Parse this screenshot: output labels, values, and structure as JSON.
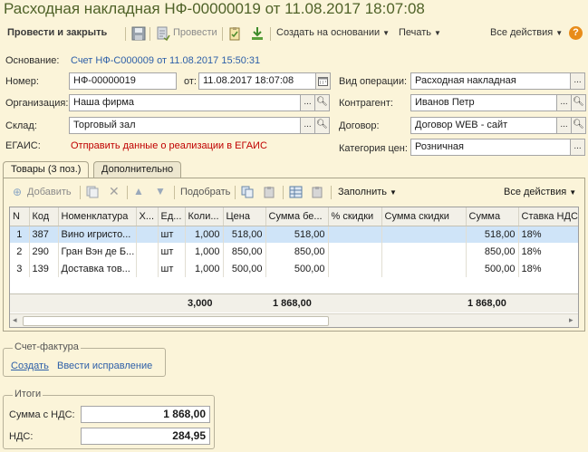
{
  "window": {
    "title": "Расходная накладная НФ-00000019 от 11.08.2017 18:07:08"
  },
  "toolbar": {
    "post_close": "Провести и закрыть",
    "post": "Провести",
    "create_based": "Создать на основании",
    "print": "Печать",
    "all_actions": "Все действия",
    "help": "?"
  },
  "form": {
    "basis_label": "Основание:",
    "basis_link": "Счет НФ-С000009 от 11.08.2017 15:50:31",
    "number_label": "Номер:",
    "number_value": "НФ-00000019",
    "date_label": "от:",
    "date_value": "11.08.2017 18:07:08",
    "operation_label": "Вид операции:",
    "operation_value": "Расходная накладная",
    "org_label": "Организация:",
    "org_value": "Наша фирма",
    "counterparty_label": "Контрагент:",
    "counterparty_value": "Иванов Петр",
    "warehouse_label": "Склад:",
    "warehouse_value": "Торговый зал",
    "contract_label": "Договор:",
    "contract_value": "Договор WEB - сайт",
    "egais_label": "ЕГАИС:",
    "egais_link": "Отправить данные о реализации в ЕГАИС",
    "price_category_label": "Категория цен:",
    "price_category_value": "Розничная"
  },
  "tabs": [
    {
      "label": "Товары (3 поз.)",
      "active": true
    },
    {
      "label": "Дополнительно",
      "active": false
    }
  ],
  "goods_toolbar": {
    "add": "Добавить",
    "pick": "Подобрать",
    "fill": "Заполнить",
    "all_actions": "Все действия"
  },
  "grid": {
    "headers": [
      "N",
      "Код",
      "Номенклатура",
      "Х...",
      "Ед...",
      "Коли...",
      "Цена",
      "Сумма бе...",
      "% скидки",
      "Сумма скидки",
      "Сумма",
      "Ставка НДС"
    ],
    "rows": [
      {
        "n": "1",
        "code": "387",
        "name": "Вино игристо...",
        "x": "",
        "unit": "шт",
        "qty": "1,000",
        "price": "518,00",
        "sum_no_disc": "518,00",
        "disc_pct": "",
        "disc_sum": "",
        "sum": "518,00",
        "vat": "18%"
      },
      {
        "n": "2",
        "code": "290",
        "name": "Гран Вэн де Б...",
        "x": "",
        "unit": "шт",
        "qty": "1,000",
        "price": "850,00",
        "sum_no_disc": "850,00",
        "disc_pct": "",
        "disc_sum": "",
        "sum": "850,00",
        "vat": "18%"
      },
      {
        "n": "3",
        "code": "139",
        "name": "Доставка тов...",
        "x": "",
        "unit": "шт",
        "qty": "1,000",
        "price": "500,00",
        "sum_no_disc": "500,00",
        "disc_pct": "",
        "disc_sum": "",
        "sum": "500,00",
        "vat": "18%"
      }
    ],
    "totals": {
      "qty": "3,000",
      "sum_no_disc": "1 868,00",
      "sum": "1 868,00"
    }
  },
  "invoice": {
    "title": "Счет-фактура",
    "create": "Создать",
    "correction": "Ввести исправление"
  },
  "totals": {
    "title": "Итоги",
    "sum_vat_label": "Сумма с НДС:",
    "sum_vat_value": "1 868,00",
    "vat_label": "НДС:",
    "vat_value": "284,95"
  },
  "colors": {
    "title": "#4f6228",
    "link": "#2d5fa8",
    "egais": "#c00000",
    "selected_row": "#cfe4f8",
    "background": "#fbf4d9"
  }
}
